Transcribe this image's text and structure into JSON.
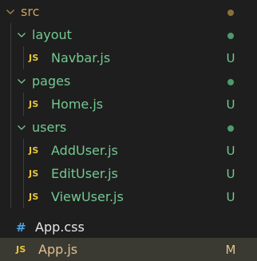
{
  "colors": {
    "background": "#1e1e1e",
    "selected_bg": "#3a3a32",
    "untracked_green": "#73c991",
    "modified_yellow": "#e2c08d",
    "folder_text_muted": "#8b7a4e",
    "js_icon": "#e8c53a",
    "css_icon": "#4aa3e8"
  },
  "tree": {
    "src": {
      "label": "src",
      "status_dot": "brown"
    },
    "layout": {
      "label": "layout",
      "status_dot": "green"
    },
    "navbar": {
      "icon": "JS",
      "label": "Navbar.js",
      "status": "U"
    },
    "pages": {
      "label": "pages",
      "status_dot": "green"
    },
    "home": {
      "icon": "JS",
      "label": "Home.js",
      "status": "U"
    },
    "users": {
      "label": "users",
      "status_dot": "green"
    },
    "adduser": {
      "icon": "JS",
      "label": "AddUser.js",
      "status": "U"
    },
    "edituser": {
      "icon": "JS",
      "label": "EditUser.js",
      "status": "U"
    },
    "viewuser": {
      "icon": "JS",
      "label": "ViewUser.js",
      "status": "U"
    },
    "appcss": {
      "icon": "#",
      "label": "App.css"
    },
    "appjs": {
      "icon": "JS",
      "label": "App.js",
      "status": "M"
    }
  }
}
